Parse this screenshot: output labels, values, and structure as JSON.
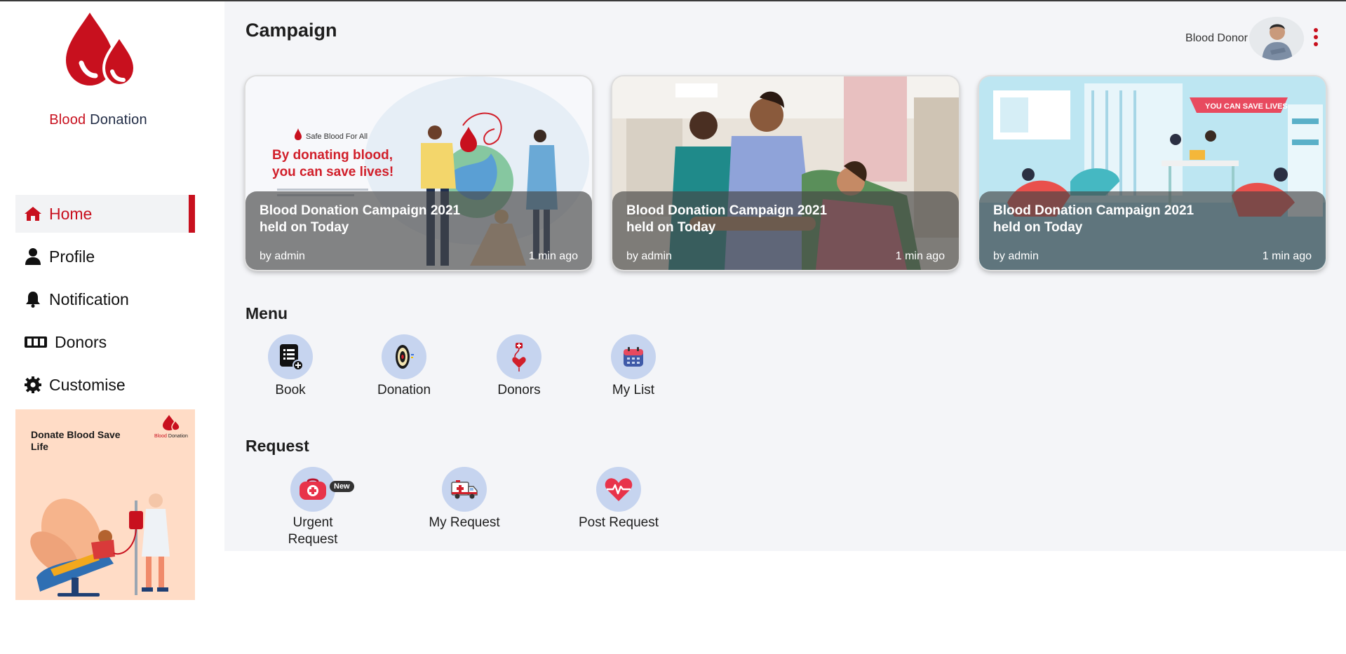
{
  "brand": {
    "name_red": "Blood",
    "name_dark": "Donation",
    "accent_color": "#c8101e"
  },
  "sidebar": {
    "items": [
      {
        "label": "Home",
        "icon": "home-icon",
        "active": true
      },
      {
        "label": "Profile",
        "icon": "user-icon",
        "active": false
      },
      {
        "label": "Notification",
        "icon": "bell-icon",
        "active": false
      },
      {
        "label": "Donors",
        "icon": "id-cards-icon",
        "active": false
      },
      {
        "label": "Customise",
        "icon": "gear-icon",
        "active": false
      }
    ],
    "promo": {
      "title": "Donate Blood Save Life",
      "logo_red": "Blood",
      "logo_dark": "Donation"
    }
  },
  "header": {
    "title": "Campaign",
    "user_name": "Blood Donor"
  },
  "campaigns": [
    {
      "title": "Blood Donation Campaign 2021 held on Today",
      "author": "by admin",
      "time": "1 min ago",
      "poster_tag": "Safe Blood For All",
      "poster_headline": "By donating blood, you can save lives!"
    },
    {
      "title": "Blood Donation Campaign 2021 held on Today",
      "author": "by admin",
      "time": "1 min ago"
    },
    {
      "title": "Blood Donation Campaign 2021 held on Today",
      "author": "by admin",
      "time": "1 min ago",
      "poster_banner": "YOU CAN SAVE LIVES"
    }
  ],
  "menu": {
    "title": "Menu",
    "items": [
      {
        "label": "Book",
        "icon": "book-list-icon"
      },
      {
        "label": "Donation",
        "icon": "dartboard-icon"
      },
      {
        "label": "Donors",
        "icon": "heart-drip-icon"
      },
      {
        "label": "My List",
        "icon": "calendar-icon"
      }
    ]
  },
  "request": {
    "title": "Request",
    "items": [
      {
        "label": "Urgent Request",
        "icon": "medical-bag-icon",
        "badge": "New"
      },
      {
        "label": "My Request",
        "icon": "ambulance-icon"
      },
      {
        "label": "Post Request",
        "icon": "heartbeat-icon"
      }
    ]
  }
}
